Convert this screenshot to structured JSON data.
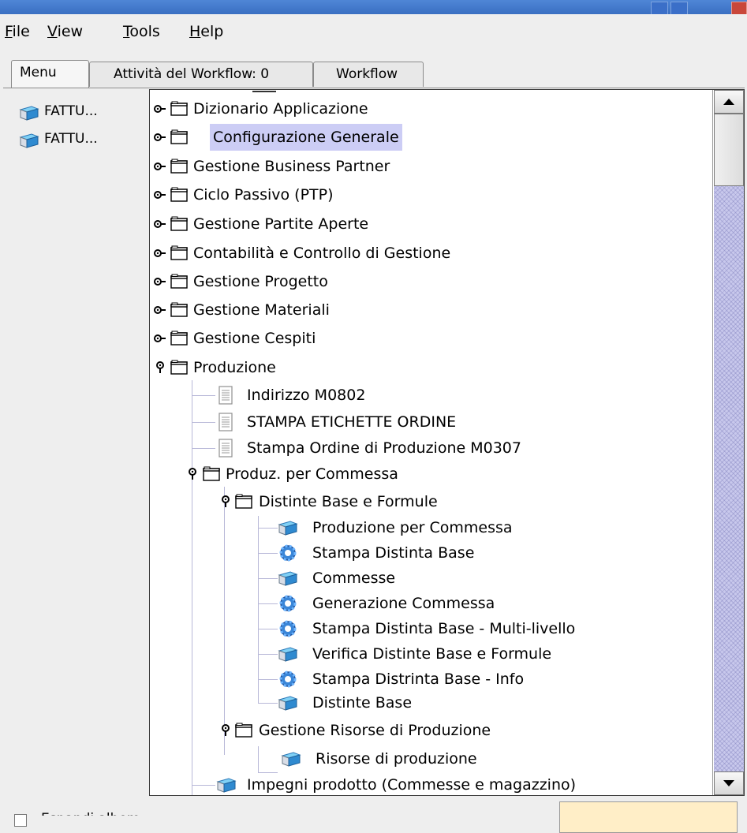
{
  "menubar": {
    "file": {
      "accel": "F",
      "rest": "ile"
    },
    "view": {
      "accel": "V",
      "rest": "iew"
    },
    "tools": {
      "accel": "T",
      "rest": "ools"
    },
    "help": {
      "accel": "H",
      "rest": "elp"
    }
  },
  "tabs": [
    {
      "label": "Menu"
    },
    {
      "label": "Attività del Workflow: 0"
    },
    {
      "label": "Workflow"
    }
  ],
  "left_panel": {
    "items": [
      {
        "label": "FATTU..."
      },
      {
        "label": "FATTU..."
      }
    ]
  },
  "tree": {
    "top": [
      {
        "label": "Dizionario Applicazione"
      },
      {
        "label": "Configurazione Generale"
      },
      {
        "label": "Gestione Business Partner"
      },
      {
        "label": "Ciclo Passivo (PTP)"
      },
      {
        "label": "Gestione Partite Aperte"
      },
      {
        "label": "Contabilità e Controllo di Gestione"
      },
      {
        "label": "Gestione Progetto"
      },
      {
        "label": "Gestione Materiali"
      },
      {
        "label": "Gestione Cespiti"
      },
      {
        "label": "Produzione"
      }
    ],
    "produzione": [
      {
        "label": "Indirizzo M0802"
      },
      {
        "label": "STAMPA ETICHETTE ORDINE"
      },
      {
        "label": "Stampa Ordine di Produzione M0307"
      },
      {
        "label": "Produz. per Commessa"
      }
    ],
    "produz_commessa": [
      {
        "label": "Distinte Base e Formule"
      }
    ],
    "distinte": [
      {
        "label": "Produzione per Commessa"
      },
      {
        "label": "Stampa Distinta Base"
      },
      {
        "label": "Commesse"
      },
      {
        "label": "Generazione Commessa"
      },
      {
        "label": "Stampa Distinta Base - Multi-livello"
      },
      {
        "label": "Verifica Distinte Base e Formule"
      },
      {
        "label": "Stampa Distrinta Base - Info"
      },
      {
        "label": "Distinte Base"
      }
    ],
    "risorse_folder": {
      "label": "Gestione Risorse di Produzione"
    },
    "risorse_item": {
      "label": "Risorse di produzione"
    },
    "impegni": {
      "label": "Impegni prodotto (Commesse e magazzino)"
    }
  },
  "footer": {
    "checkbox_label": "Espandi albero"
  },
  "colors": {
    "selection": "#cccdf5",
    "title_bar": "#3a6fc2",
    "scroll_track": "#c8c8ec"
  }
}
